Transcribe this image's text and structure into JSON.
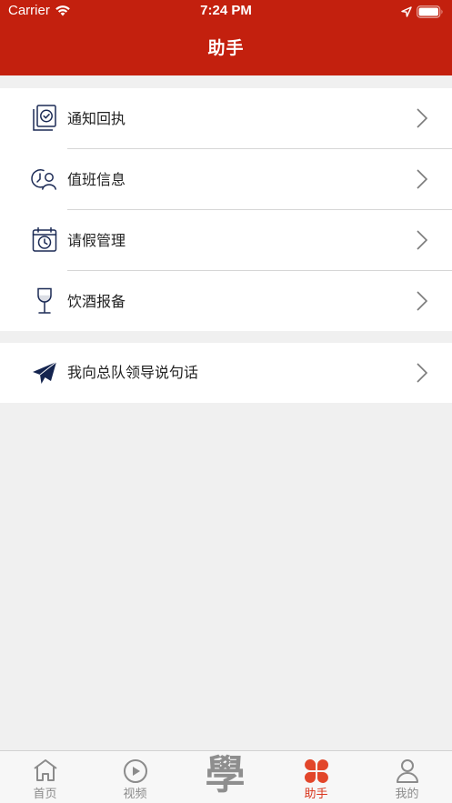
{
  "status_bar": {
    "carrier": "Carrier",
    "time": "7:24 PM"
  },
  "header": {
    "title": "助手",
    "background": "#c3200e"
  },
  "menu": {
    "items": [
      {
        "label": "通知回执",
        "icon": "checked-document-icon"
      },
      {
        "label": "值班信息",
        "icon": "duty-person-clock-icon"
      },
      {
        "label": "请假管理",
        "icon": "calendar-clock-icon"
      },
      {
        "label": "饮酒报备",
        "icon": "wine-glass-icon"
      }
    ],
    "extra_item": {
      "label": "我向总队领导说句话",
      "icon": "paper-plane-icon"
    }
  },
  "tabbar": {
    "tabs": [
      {
        "label": "首页",
        "icon": "home-icon"
      },
      {
        "label": "视频",
        "icon": "play-circle-icon"
      },
      {
        "label": "學",
        "icon": "xue-logo-icon"
      },
      {
        "label": "助手",
        "icon": "four-petal-icon",
        "active": true
      },
      {
        "label": "我的",
        "icon": "person-icon"
      }
    ],
    "active_color": "#d9361d",
    "inactive_color": "#8b8b8b"
  }
}
